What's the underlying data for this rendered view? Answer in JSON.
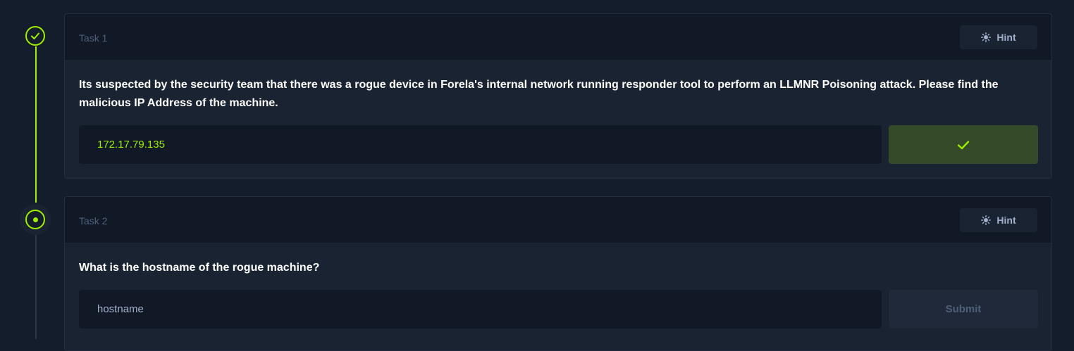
{
  "tasks": [
    {
      "label": "Task 1",
      "hint_label": "Hint",
      "question": "Its suspected by the security team that there was a rogue device in Forela's internal network running responder tool to perform an LLMNR Poisoning attack. Please find the malicious IP Address of the machine.",
      "answer_value": "172.17.79.135",
      "status": "completed",
      "submit_icon": "check-icon"
    },
    {
      "label": "Task 2",
      "hint_label": "Hint",
      "question": "What is the hostname of the rogue machine?",
      "answer_placeholder": "hostname",
      "submit_label": "Submit",
      "status": "active"
    }
  ],
  "colors": {
    "accent": "#9fef00",
    "background": "#141d2b",
    "card": "#1a2332",
    "card_header": "#111927",
    "success_button": "#344a28"
  }
}
